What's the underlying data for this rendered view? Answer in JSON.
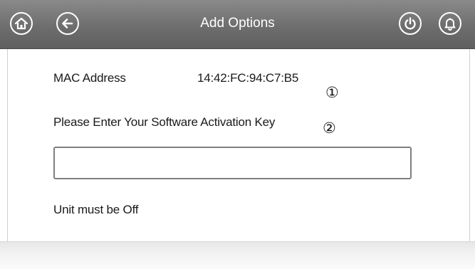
{
  "header": {
    "title": "Add Options",
    "icons": {
      "home": "home-icon",
      "back": "back-arrow-icon",
      "power": "power-icon",
      "alarm": "bell-icon"
    },
    "bar_color": "#6e6e6e",
    "icon_color": "#ffffff"
  },
  "main": {
    "mac_label": "MAC Address",
    "mac_value": "14:42:FC:94:C7:B5",
    "marker_1": "①",
    "activation_prompt": "Please Enter Your Software Activation Key",
    "marker_2": "②",
    "activation_input": {
      "value": "",
      "placeholder": ""
    },
    "note": "Unit must be Off"
  }
}
